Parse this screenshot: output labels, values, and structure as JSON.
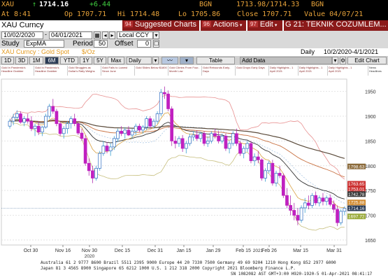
{
  "ticker": {
    "symbol": "XAU",
    "price": "1714.16",
    "change": "+6.44",
    "source": "BGN",
    "bid_ask": "1713.98/1714.33",
    "source2": "BGN",
    "time": "At 8:41",
    "open": "Op 1707.71",
    "high": "Hi 1714.48",
    "low": "Lo 1705.86",
    "close": "Close 1707.71",
    "value": "Value 04/07/21"
  },
  "header": {
    "title": "XAU Curncy",
    "tabs": [
      {
        "num": "94",
        "label": "Suggested Charts"
      },
      {
        "num": "96",
        "label": "Actions"
      },
      {
        "num": "97",
        "label": "Edit"
      },
      {
        "num": "",
        "label": "G 21: TEKNIK COZUMLEM..."
      }
    ]
  },
  "controls": {
    "start_date": "10/02/2020",
    "end_date": "04/01/2021",
    "currency": "Local CCY",
    "study_label": "Study",
    "study_value": "ExpMA",
    "period_label": "Period",
    "period_value": "50",
    "offset_label": "Offset",
    "offset_value": "0"
  },
  "security": {
    "name": "XAU Curncy : Gold Spot",
    "unit": "$/Oz",
    "frequency": "Daily",
    "range": "10/2/2020-4/1/2021"
  },
  "periods": [
    "1D",
    "3D",
    "1M",
    "6M",
    "YTD",
    "1Y",
    "5Y",
    "Max"
  ],
  "period_selected": "6M",
  "toolbar": {
    "frequency": "Daily",
    "table": "Table",
    "add_data": "Add Data",
    "edit_chart": "Edit Chart",
    "news": "News Headlines"
  },
  "news_items": [
    "Gold In Pandemic's Headline Grabber",
    "Gold In Pandemic's Headline Grabber",
    "Gold Struggles as Dollar's Rally Weighs",
    "Gold Falls to Lowest Since June",
    "Gold Slides Below $1800",
    "Gold Climbs From Four-Month Low",
    "Gold Rebounds Early-Days",
    "Gold Drops Early Days",
    "Daily Highlights - 1 April 2021",
    "Daily Highlights - 1 April 2021",
    "Daily Highlights - 1 April 2021"
  ],
  "chart_data": {
    "type": "candlestick",
    "yticks": [
      1650,
      1700,
      1750,
      1800,
      1850,
      1900,
      1950
    ],
    "ylim": [
      1640,
      1975
    ],
    "xticks": [
      "Oct 30",
      "Nov 16",
      "Nov 30",
      "Dec 15",
      "Dec 31",
      "Jan 15",
      "Jan 29",
      "Feb 15",
      "Feb 26",
      "Mar 15",
      "Mar 31"
    ],
    "year_labels": [
      "2020",
      "2021"
    ],
    "price_tags": [
      {
        "label": "1798.63",
        "value": 1798.63,
        "color": "#8b6a3a"
      },
      {
        "label": "1763.65",
        "value": 1763.65,
        "color": "#cc3333"
      },
      {
        "label": "1753.01",
        "value": 1753.01,
        "color": "#cc3333"
      },
      {
        "label": "1742.78",
        "value": 1742.78,
        "color": "#3a3a3a"
      },
      {
        "label": "1725.88",
        "value": 1725.88,
        "color": "#d08a30"
      },
      {
        "label": "1714.16",
        "value": 1714.16,
        "color": "#2a3b55"
      },
      {
        "label": "1697.72",
        "value": 1697.72,
        "color": "#9aaa3a"
      }
    ],
    "candles": [
      [
        1880,
        1895,
        1875,
        1890
      ],
      [
        1890,
        1905,
        1882,
        1898
      ],
      [
        1898,
        1912,
        1890,
        1905
      ],
      [
        1905,
        1910,
        1885,
        1888
      ],
      [
        1888,
        1900,
        1880,
        1895
      ],
      [
        1895,
        1905,
        1885,
        1890
      ],
      [
        1890,
        1900,
        1870,
        1875
      ],
      [
        1875,
        1885,
        1860,
        1880
      ],
      [
        1880,
        1890,
        1862,
        1868
      ],
      [
        1868,
        1880,
        1860,
        1878
      ],
      [
        1878,
        1905,
        1875,
        1900
      ],
      [
        1900,
        1925,
        1895,
        1920
      ],
      [
        1920,
        1935,
        1905,
        1910
      ],
      [
        1910,
        1915,
        1880,
        1885
      ],
      [
        1885,
        1890,
        1860,
        1865
      ],
      [
        1865,
        1880,
        1855,
        1875
      ],
      [
        1875,
        1890,
        1865,
        1885
      ],
      [
        1885,
        1900,
        1875,
        1895
      ],
      [
        1895,
        1905,
        1880,
        1885
      ],
      [
        1885,
        1890,
        1862,
        1866
      ],
      [
        1866,
        1875,
        1850,
        1855
      ],
      [
        1855,
        1862,
        1800,
        1805
      ],
      [
        1805,
        1815,
        1780,
        1790
      ],
      [
        1790,
        1800,
        1765,
        1775
      ],
      [
        1775,
        1800,
        1770,
        1795
      ],
      [
        1795,
        1830,
        1790,
        1825
      ],
      [
        1825,
        1850,
        1820,
        1840
      ],
      [
        1840,
        1848,
        1825,
        1830
      ],
      [
        1830,
        1845,
        1820,
        1838
      ],
      [
        1838,
        1860,
        1832,
        1855
      ],
      [
        1855,
        1875,
        1848,
        1870
      ],
      [
        1870,
        1880,
        1860,
        1865
      ],
      [
        1865,
        1878,
        1855,
        1872
      ],
      [
        1872,
        1880,
        1860,
        1862
      ],
      [
        1862,
        1875,
        1855,
        1870
      ],
      [
        1870,
        1885,
        1862,
        1880
      ],
      [
        1880,
        1885,
        1868,
        1872
      ],
      [
        1872,
        1882,
        1865,
        1878
      ],
      [
        1878,
        1900,
        1872,
        1895
      ],
      [
        1895,
        1900,
        1875,
        1880
      ],
      [
        1880,
        1895,
        1875,
        1890
      ],
      [
        1890,
        1910,
        1885,
        1905
      ],
      [
        1905,
        1955,
        1900,
        1948
      ],
      [
        1948,
        1960,
        1935,
        1945
      ],
      [
        1945,
        1952,
        1910,
        1915
      ],
      [
        1915,
        1920,
        1840,
        1850
      ],
      [
        1850,
        1860,
        1835,
        1845
      ],
      [
        1845,
        1860,
        1838,
        1855
      ],
      [
        1855,
        1862,
        1828,
        1835
      ],
      [
        1835,
        1850,
        1825,
        1845
      ],
      [
        1845,
        1865,
        1840,
        1858
      ],
      [
        1858,
        1870,
        1850,
        1862
      ],
      [
        1862,
        1872,
        1850,
        1855
      ],
      [
        1855,
        1868,
        1848,
        1865
      ],
      [
        1865,
        1870,
        1840,
        1845
      ],
      [
        1845,
        1860,
        1838,
        1850
      ],
      [
        1850,
        1870,
        1845,
        1865
      ],
      [
        1865,
        1875,
        1855,
        1860
      ],
      [
        1860,
        1870,
        1845,
        1850
      ],
      [
        1850,
        1865,
        1845,
        1860
      ],
      [
        1860,
        1865,
        1830,
        1835
      ],
      [
        1835,
        1850,
        1825,
        1845
      ],
      [
        1845,
        1870,
        1840,
        1865
      ],
      [
        1865,
        1875,
        1840,
        1845
      ],
      [
        1845,
        1850,
        1820,
        1825
      ],
      [
        1825,
        1840,
        1815,
        1835
      ],
      [
        1835,
        1850,
        1828,
        1845
      ],
      [
        1845,
        1850,
        1805,
        1810
      ],
      [
        1810,
        1825,
        1800,
        1818
      ],
      [
        1818,
        1830,
        1805,
        1812
      ],
      [
        1812,
        1815,
        1770,
        1775
      ],
      [
        1775,
        1795,
        1768,
        1790
      ],
      [
        1790,
        1810,
        1785,
        1805
      ],
      [
        1805,
        1812,
        1760,
        1765
      ],
      [
        1765,
        1790,
        1758,
        1785
      ],
      [
        1785,
        1800,
        1775,
        1780
      ],
      [
        1780,
        1785,
        1735,
        1740
      ],
      [
        1740,
        1755,
        1715,
        1720
      ],
      [
        1720,
        1740,
        1700,
        1710
      ],
      [
        1710,
        1725,
        1690,
        1700
      ],
      [
        1700,
        1715,
        1680,
        1690
      ],
      [
        1690,
        1720,
        1685,
        1715
      ],
      [
        1715,
        1735,
        1705,
        1725
      ],
      [
        1725,
        1740,
        1712,
        1720
      ],
      [
        1720,
        1745,
        1715,
        1740
      ],
      [
        1740,
        1748,
        1720,
        1725
      ],
      [
        1725,
        1740,
        1718,
        1735
      ],
      [
        1735,
        1745,
        1720,
        1728
      ],
      [
        1728,
        1740,
        1720,
        1735
      ],
      [
        1735,
        1742,
        1718,
        1722
      ],
      [
        1722,
        1730,
        1705,
        1712
      ],
      [
        1712,
        1720,
        1678,
        1685
      ],
      [
        1685,
        1712,
        1680,
        1708
      ],
      [
        1708,
        1718,
        1700,
        1714
      ]
    ]
  },
  "footer": {
    "line1": "Australia 61 2 9777 8600 Brazil 5511 2395 9000 Europe 44 20 7330 7500 Germany 49 69 9204 1210 Hong Kong 852 2977 6000",
    "line2": "Japan 81 3 4565 8900      Singapore 65 6212 1000       U.S. 1 212 318 2000         Copyright 2021 Bloomberg Finance L.P.",
    "line3": "SN 1082082 AST  GMT+3:00 H920-1920-5 01-Apr-2021 08:41:17"
  }
}
